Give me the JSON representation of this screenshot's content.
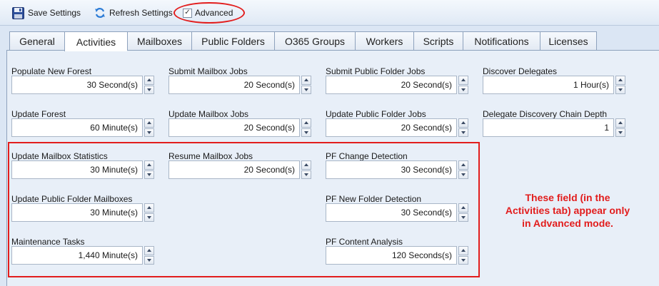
{
  "toolbar": {
    "save_label": "Save Settings",
    "refresh_label": "Refresh Settings",
    "advanced_label": "Advanced",
    "advanced_checked": "✓"
  },
  "tabs": [
    "General",
    "Activities",
    "Mailboxes",
    "Public Folders",
    "O365 Groups",
    "Workers",
    "Scripts",
    "Notifications",
    "Licenses"
  ],
  "active_tab": "Activities",
  "fields": {
    "populate_new_forest": {
      "label": "Populate New Forest",
      "value": "30 Second(s)"
    },
    "submit_mailbox_jobs": {
      "label": "Submit Mailbox Jobs",
      "value": "20 Second(s)"
    },
    "submit_public_folder_jobs": {
      "label": "Submit Public Folder Jobs",
      "value": "20 Second(s)"
    },
    "discover_delegates": {
      "label": "Discover Delegates",
      "value": "1 Hour(s)"
    },
    "update_forest": {
      "label": "Update Forest",
      "value": "60 Minute(s)"
    },
    "update_mailbox_jobs": {
      "label": "Update Mailbox Jobs",
      "value": "20 Second(s)"
    },
    "update_public_folder_jobs": {
      "label": "Update Public Folder Jobs",
      "value": "20 Second(s)"
    },
    "delegate_discovery_chain_depth": {
      "label": "Delegate Discovery Chain Depth",
      "value": "1"
    },
    "update_mailbox_statistics": {
      "label": "Update Mailbox Statistics",
      "value": "30 Minute(s)"
    },
    "resume_mailbox_jobs": {
      "label": "Resume Mailbox Jobs",
      "value": "20 Second(s)"
    },
    "pf_change_detection": {
      "label": "PF Change Detection",
      "value": "30 Second(s)"
    },
    "update_public_folder_mailboxes": {
      "label": "Update Public Folder Mailboxes",
      "value": "30 Minute(s)"
    },
    "pf_new_folder_detection": {
      "label": "PF New Folder Detection",
      "value": "30 Second(s)"
    },
    "maintenance_tasks": {
      "label": "Maintenance Tasks",
      "value": "1,440 Minute(s)"
    },
    "pf_content_analysis": {
      "label": "PF Content Analysis",
      "value": "120 Seconds(s)"
    }
  },
  "annotation": {
    "line1": "These field (in the",
    "line2": "Activities tab) appear only",
    "line3": "in Advanced mode."
  },
  "colors": {
    "annotation_red": "#e21d1d",
    "panel_bg": "#e8eff8",
    "toolbar_bg": "#dfe9f5"
  }
}
